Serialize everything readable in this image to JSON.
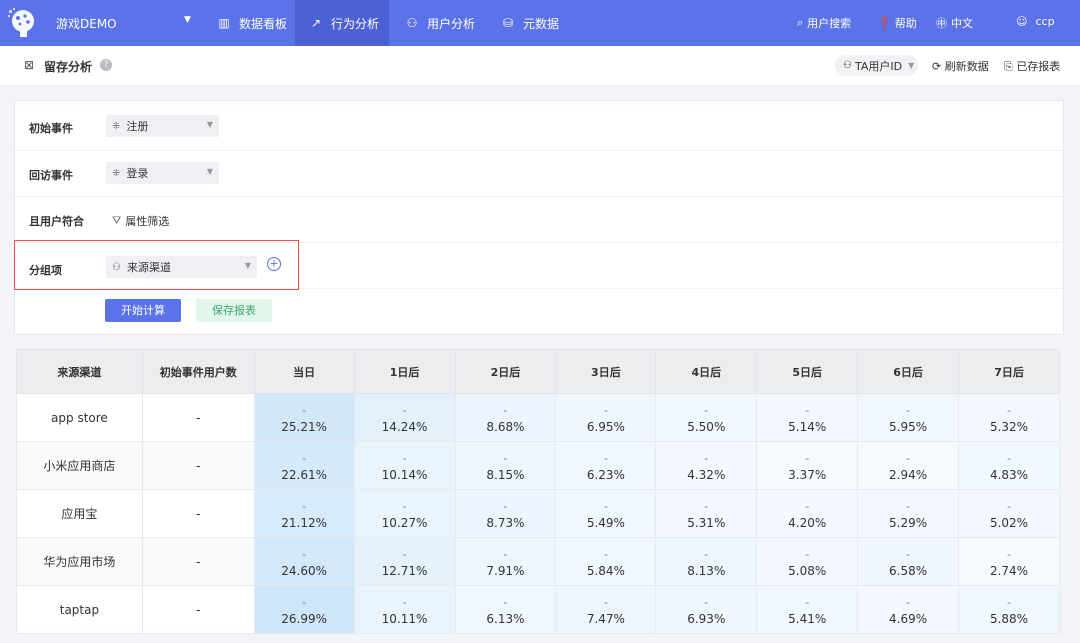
{
  "nav": {
    "project": "游戏DEMO",
    "items": [
      {
        "label": "数据看板",
        "icon": "dashboard-icon"
      },
      {
        "label": "行为分析",
        "icon": "trend-icon",
        "active": true
      },
      {
        "label": "用户分析",
        "icon": "user-icon"
      },
      {
        "label": "元数据",
        "icon": "database-icon"
      }
    ],
    "right": {
      "search": "用户搜索",
      "help": "帮助",
      "lang": "中文",
      "user": "ccp"
    }
  },
  "subheader": {
    "title": "留存分析",
    "id_selector": "TA用户ID",
    "refresh": "刷新数据",
    "saved_reports": "已存报表"
  },
  "config": {
    "initial_event": {
      "label": "初始事件",
      "value": "注册"
    },
    "return_event": {
      "label": "回访事件",
      "value": "登录"
    },
    "user_filter": {
      "label": "且用户符合",
      "link": "属性筛选"
    },
    "group_by": {
      "label": "分组项",
      "value": "来源渠道"
    },
    "compute_button": "开始计算",
    "save_button": "保存报表"
  },
  "table": {
    "headers": [
      "来源渠道",
      "初始事件用户数",
      "当日",
      "1日后",
      "2日后",
      "3日后",
      "4日后",
      "5日后",
      "6日后",
      "7日后"
    ],
    "rows": [
      {
        "channel": "app store",
        "users": "-",
        "values": [
          "25.21%",
          "14.24%",
          "8.68%",
          "6.95%",
          "5.50%",
          "5.14%",
          "5.95%",
          "5.32%"
        ]
      },
      {
        "channel": "小米应用商店",
        "users": "-",
        "values": [
          "22.61%",
          "10.14%",
          "8.15%",
          "6.23%",
          "4.32%",
          "3.37%",
          "2.94%",
          "4.83%"
        ]
      },
      {
        "channel": "应用宝",
        "users": "-",
        "values": [
          "21.12%",
          "10.27%",
          "8.73%",
          "5.49%",
          "5.31%",
          "4.20%",
          "5.29%",
          "5.02%"
        ]
      },
      {
        "channel": "华为应用市场",
        "users": "-",
        "values": [
          "24.60%",
          "12.71%",
          "7.91%",
          "5.84%",
          "8.13%",
          "5.08%",
          "6.58%",
          "2.74%"
        ]
      },
      {
        "channel": "taptap",
        "users": "-",
        "values": [
          "26.99%",
          "10.11%",
          "6.13%",
          "7.47%",
          "6.93%",
          "5.41%",
          "4.69%",
          "5.88%"
        ]
      }
    ],
    "cell_dash": "-"
  },
  "colors": {
    "nav_bg": "#5b73e8",
    "nav_active": "#4c62d4",
    "highlight_border": "#e8554b",
    "heat_high": "#cfe6fa",
    "heat_low": "#f7fbfe"
  }
}
